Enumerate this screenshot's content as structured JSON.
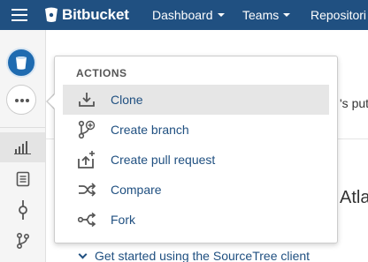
{
  "header": {
    "brand": "Bitbucket",
    "nav": [
      {
        "label": "Dashboard"
      },
      {
        "label": "Teams"
      },
      {
        "label": "Repositori"
      }
    ]
  },
  "background": {
    "snippet_right": "'s put",
    "heading_right": "Atla",
    "link_text": "Get started using the SourceTree client"
  },
  "menu": {
    "heading": "ACTIONS",
    "items": [
      {
        "label": "Clone",
        "icon": "download-icon"
      },
      {
        "label": "Create branch",
        "icon": "branch-icon"
      },
      {
        "label": "Create pull request",
        "icon": "pull-request-icon"
      },
      {
        "label": "Compare",
        "icon": "compare-icon"
      },
      {
        "label": "Fork",
        "icon": "fork-icon"
      }
    ]
  },
  "colors": {
    "navbar": "#205081",
    "link": "#205081"
  }
}
